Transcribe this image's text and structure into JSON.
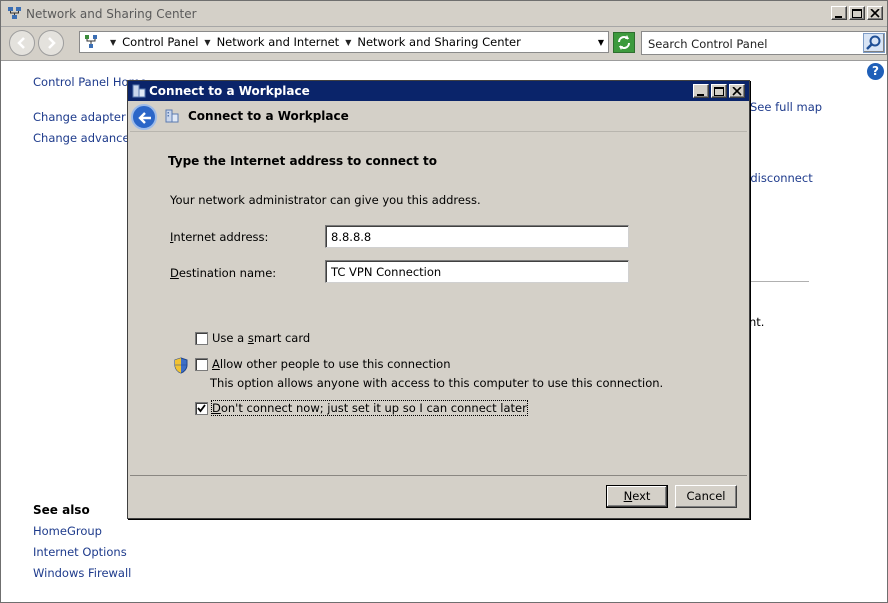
{
  "window": {
    "title": "Network and Sharing Center"
  },
  "navbar": {
    "breadcrumbs": [
      "Control Panel",
      "Network and Internet",
      "Network and Sharing Center"
    ],
    "search_placeholder": "Search Control Panel"
  },
  "left_pane": {
    "home": "Control Panel Home",
    "links": [
      "Change adapter set",
      "Change advanced s"
    ],
    "see_also_title": "See also",
    "see_also": [
      "HomeGroup",
      "Internet Options",
      "Windows Firewall"
    ]
  },
  "background": {
    "see_full_map": "See full map",
    "disconnect": "r disconnect",
    "nt": "nt."
  },
  "dialog": {
    "title": "Connect to a Workplace",
    "wizard_title": "Connect to a Workplace",
    "heading": "Type the Internet address to connect to",
    "description": "Your network administrator can give you this address.",
    "internet_address_label_pre": "",
    "internet_address_label_u": "I",
    "internet_address_label_post": "nternet address:",
    "internet_address_value": "8.8.8.8",
    "destination_label_pre": "",
    "destination_label_u": "D",
    "destination_label_post": "estination name:",
    "destination_value": "TC VPN Connection",
    "smart_card_pre": "Use a ",
    "smart_card_u": "s",
    "smart_card_post": "mart card",
    "smart_card_checked": false,
    "allow_pre": "",
    "allow_u": "A",
    "allow_post": "llow other people to use this connection",
    "allow_checked": false,
    "allow_note": "This option allows anyone with access to this computer to use this connection.",
    "dont_connect_pre": "",
    "dont_connect_u": "D",
    "dont_connect_post": "on't connect now; just set it up so I can connect later",
    "dont_connect_checked": true,
    "next_pre": "",
    "next_u": "N",
    "next_post": "ext",
    "cancel": "Cancel"
  },
  "colors": {
    "dialog_title_bg": "#0a246a",
    "window_face": "#d4d0c8",
    "link": "#1e3b8c"
  }
}
